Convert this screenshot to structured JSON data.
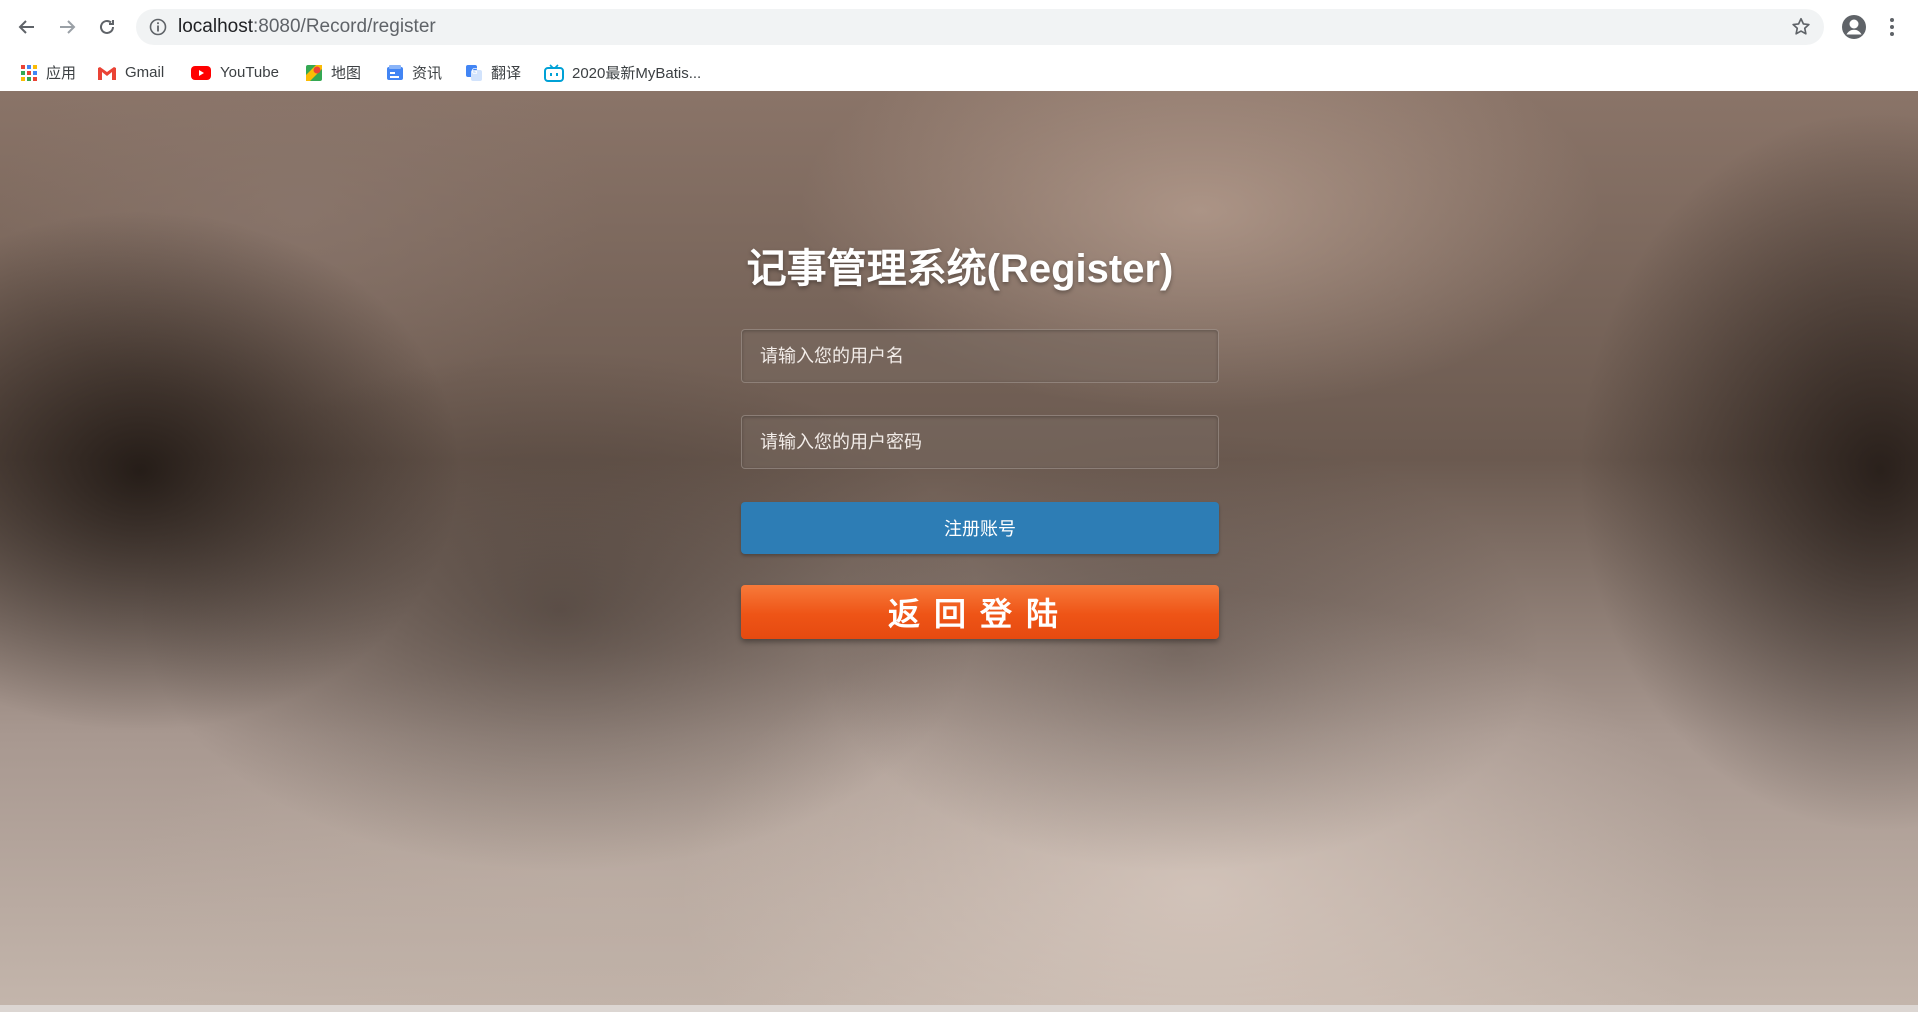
{
  "browser": {
    "url_host": "localhost",
    "url_path": ":8080/Record/register"
  },
  "bookmarks": [
    {
      "label": "应用",
      "icon": "apps-grid-icon"
    },
    {
      "label": "Gmail",
      "icon": "gmail-icon"
    },
    {
      "label": "YouTube",
      "icon": "youtube-icon"
    },
    {
      "label": "地图",
      "icon": "maps-icon"
    },
    {
      "label": "资讯",
      "icon": "news-icon"
    },
    {
      "label": "翻译",
      "icon": "translate-icon"
    },
    {
      "label": "2020最新MyBatis...",
      "icon": "bilibili-icon"
    }
  ],
  "form": {
    "title": "记事管理系统(Register)",
    "username_placeholder": "请输入您的用户名",
    "password_placeholder": "请输入您的用户密码",
    "register_label": "注册账号",
    "back_label": "返回登陆"
  },
  "colors": {
    "register_button": "#2d7db5",
    "back_button": "#ee5416"
  }
}
